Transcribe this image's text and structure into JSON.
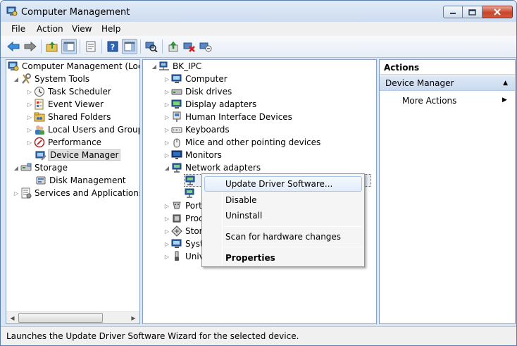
{
  "window": {
    "title": "Computer Management",
    "accent_color": "#dbe6f4"
  },
  "menubar": {
    "items": [
      "File",
      "Action",
      "View",
      "Help"
    ]
  },
  "toolbar": {
    "icons": [
      "back-arrow-icon",
      "forward-arrow-icon",
      "up-folder-icon",
      "show-hide-tree-icon",
      "properties-icon",
      "help-icon",
      "show-hide-action-pane-icon",
      "scan-hardware-icon",
      "update-driver-icon",
      "uninstall-icon",
      "disable-device-icon"
    ]
  },
  "left_tree": {
    "root": "Computer Management (Local",
    "system_tools": "System Tools",
    "task_scheduler": "Task Scheduler",
    "event_viewer": "Event Viewer",
    "shared_folders": "Shared Folders",
    "local_users": "Local Users and Groups",
    "performance": "Performance",
    "device_manager": "Device Manager",
    "storage": "Storage",
    "disk_management": "Disk Management",
    "services": "Services and Applications"
  },
  "device_tree": {
    "root": "BK_IPC",
    "computer": "Computer",
    "disk_drives": "Disk drives",
    "display_adapters": "Display adapters",
    "hid": "Human Interface Devices",
    "keyboards": "Keyboards",
    "mice": "Mice and other pointing devices",
    "monitors": "Monitors",
    "network_adapters": "Network adapters",
    "ports_partial": "Port",
    "processors_partial": "Proc",
    "storage_partial": "Stor",
    "system_partial": "Syst",
    "universal_partial": "Univ"
  },
  "context_menu": {
    "update_driver": "Update Driver Software...",
    "disable": "Disable",
    "uninstall": "Uninstall",
    "scan": "Scan for hardware changes",
    "properties": "Properties"
  },
  "actions": {
    "header": "Actions",
    "section": "Device Manager",
    "more": "More Actions"
  },
  "statusbar": {
    "text": "Launches the Update Driver Software Wizard for the selected device."
  }
}
